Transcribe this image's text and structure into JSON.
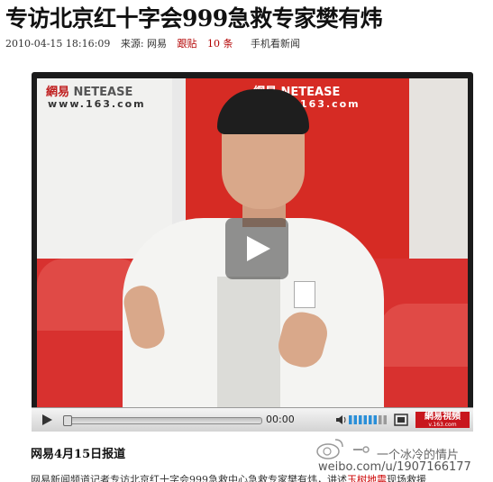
{
  "article": {
    "headline": "专访北京红十字会999急救专家樊有炜",
    "date": "2010-04-15 18:16:09",
    "source_label": "来源: 网易",
    "follow_prefix": "跟贴",
    "follow_count": "10",
    "follow_suffix": "条",
    "mobile_link": "手机看新闻",
    "report_line": "网易4月15日报道",
    "paragraph_start": "网易新闻频道记者专访北京红十字会999急救中心急救专家樊有炜，讲述",
    "paragraph_link": "玉树地震",
    "paragraph_end": "现场救援"
  },
  "video": {
    "backdrop_logo_cn": "網易",
    "backdrop_logo_en": "NETEASE",
    "backdrop_url": "www.163.com",
    "time": "00:00",
    "brand_text": "網易視頻",
    "brand_sub": "v.163.com",
    "volume_level": 0.7
  },
  "watermark": {
    "handle": "一个冰冷的情片",
    "url": "weibo.com/u/1907166177"
  },
  "colors": {
    "accent_red": "#c8161d",
    "player_bg": "#1b1b1b"
  }
}
